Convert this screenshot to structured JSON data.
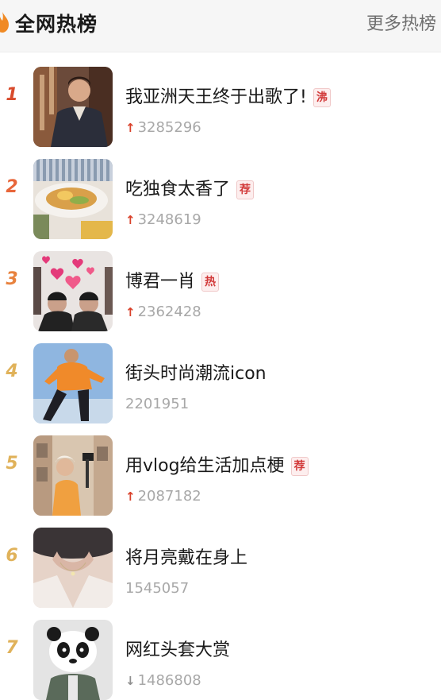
{
  "header": {
    "title": "全网热榜",
    "more_label": "更多热榜",
    "icon": "fire-icon",
    "icon_color": "#f08a24"
  },
  "rank_colors": {
    "1": "#d84a2b",
    "2": "#e8663a",
    "3": "#e8823e",
    "4": "#e0b25a",
    "5": "#e0b25a",
    "6": "#e0b25a",
    "7": "#e0b25a"
  },
  "items": [
    {
      "rank": "1",
      "title": "我亚洲天王终于出歌了!",
      "badge": "沸",
      "trend": "up",
      "count": "3285296"
    },
    {
      "rank": "2",
      "title": "吃独食太香了",
      "badge": "荐",
      "trend": "up",
      "count": "3248619"
    },
    {
      "rank": "3",
      "title": "博君一肖",
      "badge": "热",
      "trend": "up",
      "count": "2362428"
    },
    {
      "rank": "4",
      "title": "街头时尚潮流icon",
      "badge": "",
      "trend": "none",
      "count": "2201951"
    },
    {
      "rank": "5",
      "title": "用vlog给生活加点梗",
      "badge": "荐",
      "trend": "up",
      "count": "2087182"
    },
    {
      "rank": "6",
      "title": "将月亮戴在身上",
      "badge": "",
      "trend": "none",
      "count": "1545057"
    },
    {
      "rank": "7",
      "title": "网红头套大赏",
      "badge": "",
      "trend": "down",
      "count": "1486808"
    }
  ]
}
